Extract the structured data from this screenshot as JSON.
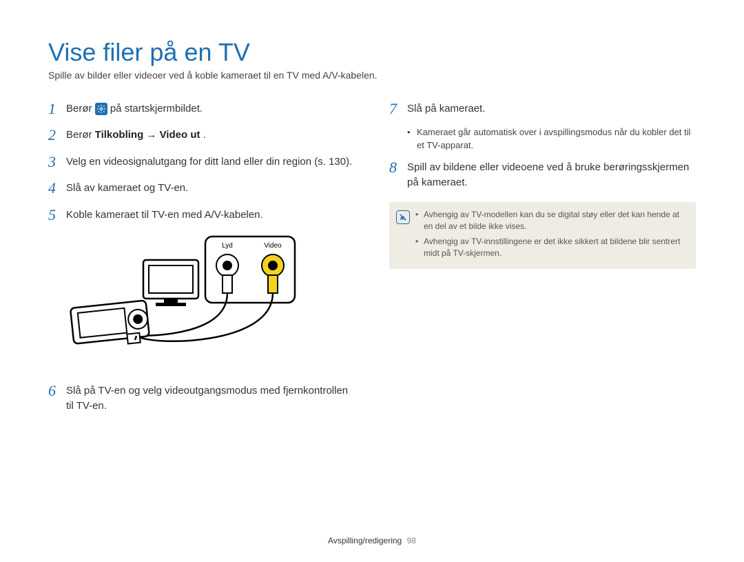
{
  "title": "Vise filer på en TV",
  "subtitle": "Spille av bilder eller videoer ved å koble kameraet til en TV med A/V-kabelen.",
  "left": {
    "steps": [
      {
        "num": "1",
        "pre": "Berør ",
        "post": " på startskjermbildet."
      },
      {
        "num": "2",
        "pre": "Berør ",
        "bold1": "Tilkobling",
        "arrow": " → ",
        "bold2": "Video ut",
        "post2": "."
      },
      {
        "num": "3",
        "text": "Velg en videosignalutgang for ditt land eller din region (s. 130)."
      },
      {
        "num": "4",
        "text": "Slå av kameraet og TV-en."
      },
      {
        "num": "5",
        "text": "Koble kameraet til TV-en med A/V-kabelen."
      },
      {
        "num": "6",
        "text": "Slå på TV-en og velg videoutgangsmodus med fjernkontrollen til TV-en."
      }
    ],
    "illus": {
      "lydLabel": "Lyd",
      "videoLabel": "Video"
    }
  },
  "right": {
    "steps": [
      {
        "num": "7",
        "text": "Slå på kameraet.",
        "bullet": "Kameraet går automatisk over i avspillingsmodus når du kobler det til et TV-apparat."
      },
      {
        "num": "8",
        "text": "Spill av bildene eller videoene ved å bruke berøringsskjermen på kameraet."
      }
    ],
    "notes": [
      "Avhengig av TV-modellen kan du se digital støy eller det kan hende at en del av et bilde ikke vises.",
      "Avhengig av TV-innstillingene er det ikke sikkert at bildene blir sentrert midt på TV-skjermen."
    ]
  },
  "footer": {
    "section": "Avspilling/redigering",
    "page": "98"
  }
}
